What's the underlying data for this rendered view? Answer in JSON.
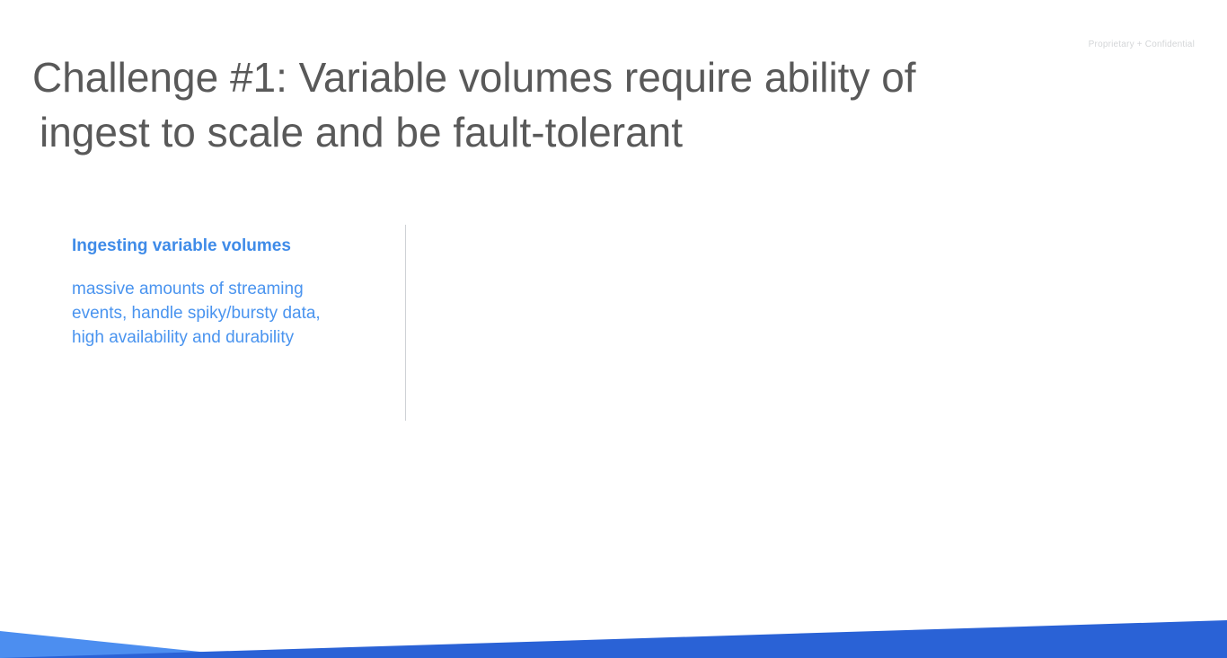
{
  "slide": {
    "confidential_label": "Proprietary + Confidential",
    "title_lines": [
      "Challenge #1: Variable volumes require ability of",
      "ingest to scale and be fault-tolerant"
    ],
    "panel": {
      "heading": "Ingesting variable volumes",
      "body_lines": [
        "massive amounts of streaming",
        "events, handle spiky/bursty data,",
        "high availability and durability"
      ]
    }
  },
  "colors": {
    "title": "#595959",
    "heading": "#3f8be8",
    "body": "#4a94ef",
    "band_dark": "#2a62d6",
    "band_light": "#4c8ef0"
  }
}
